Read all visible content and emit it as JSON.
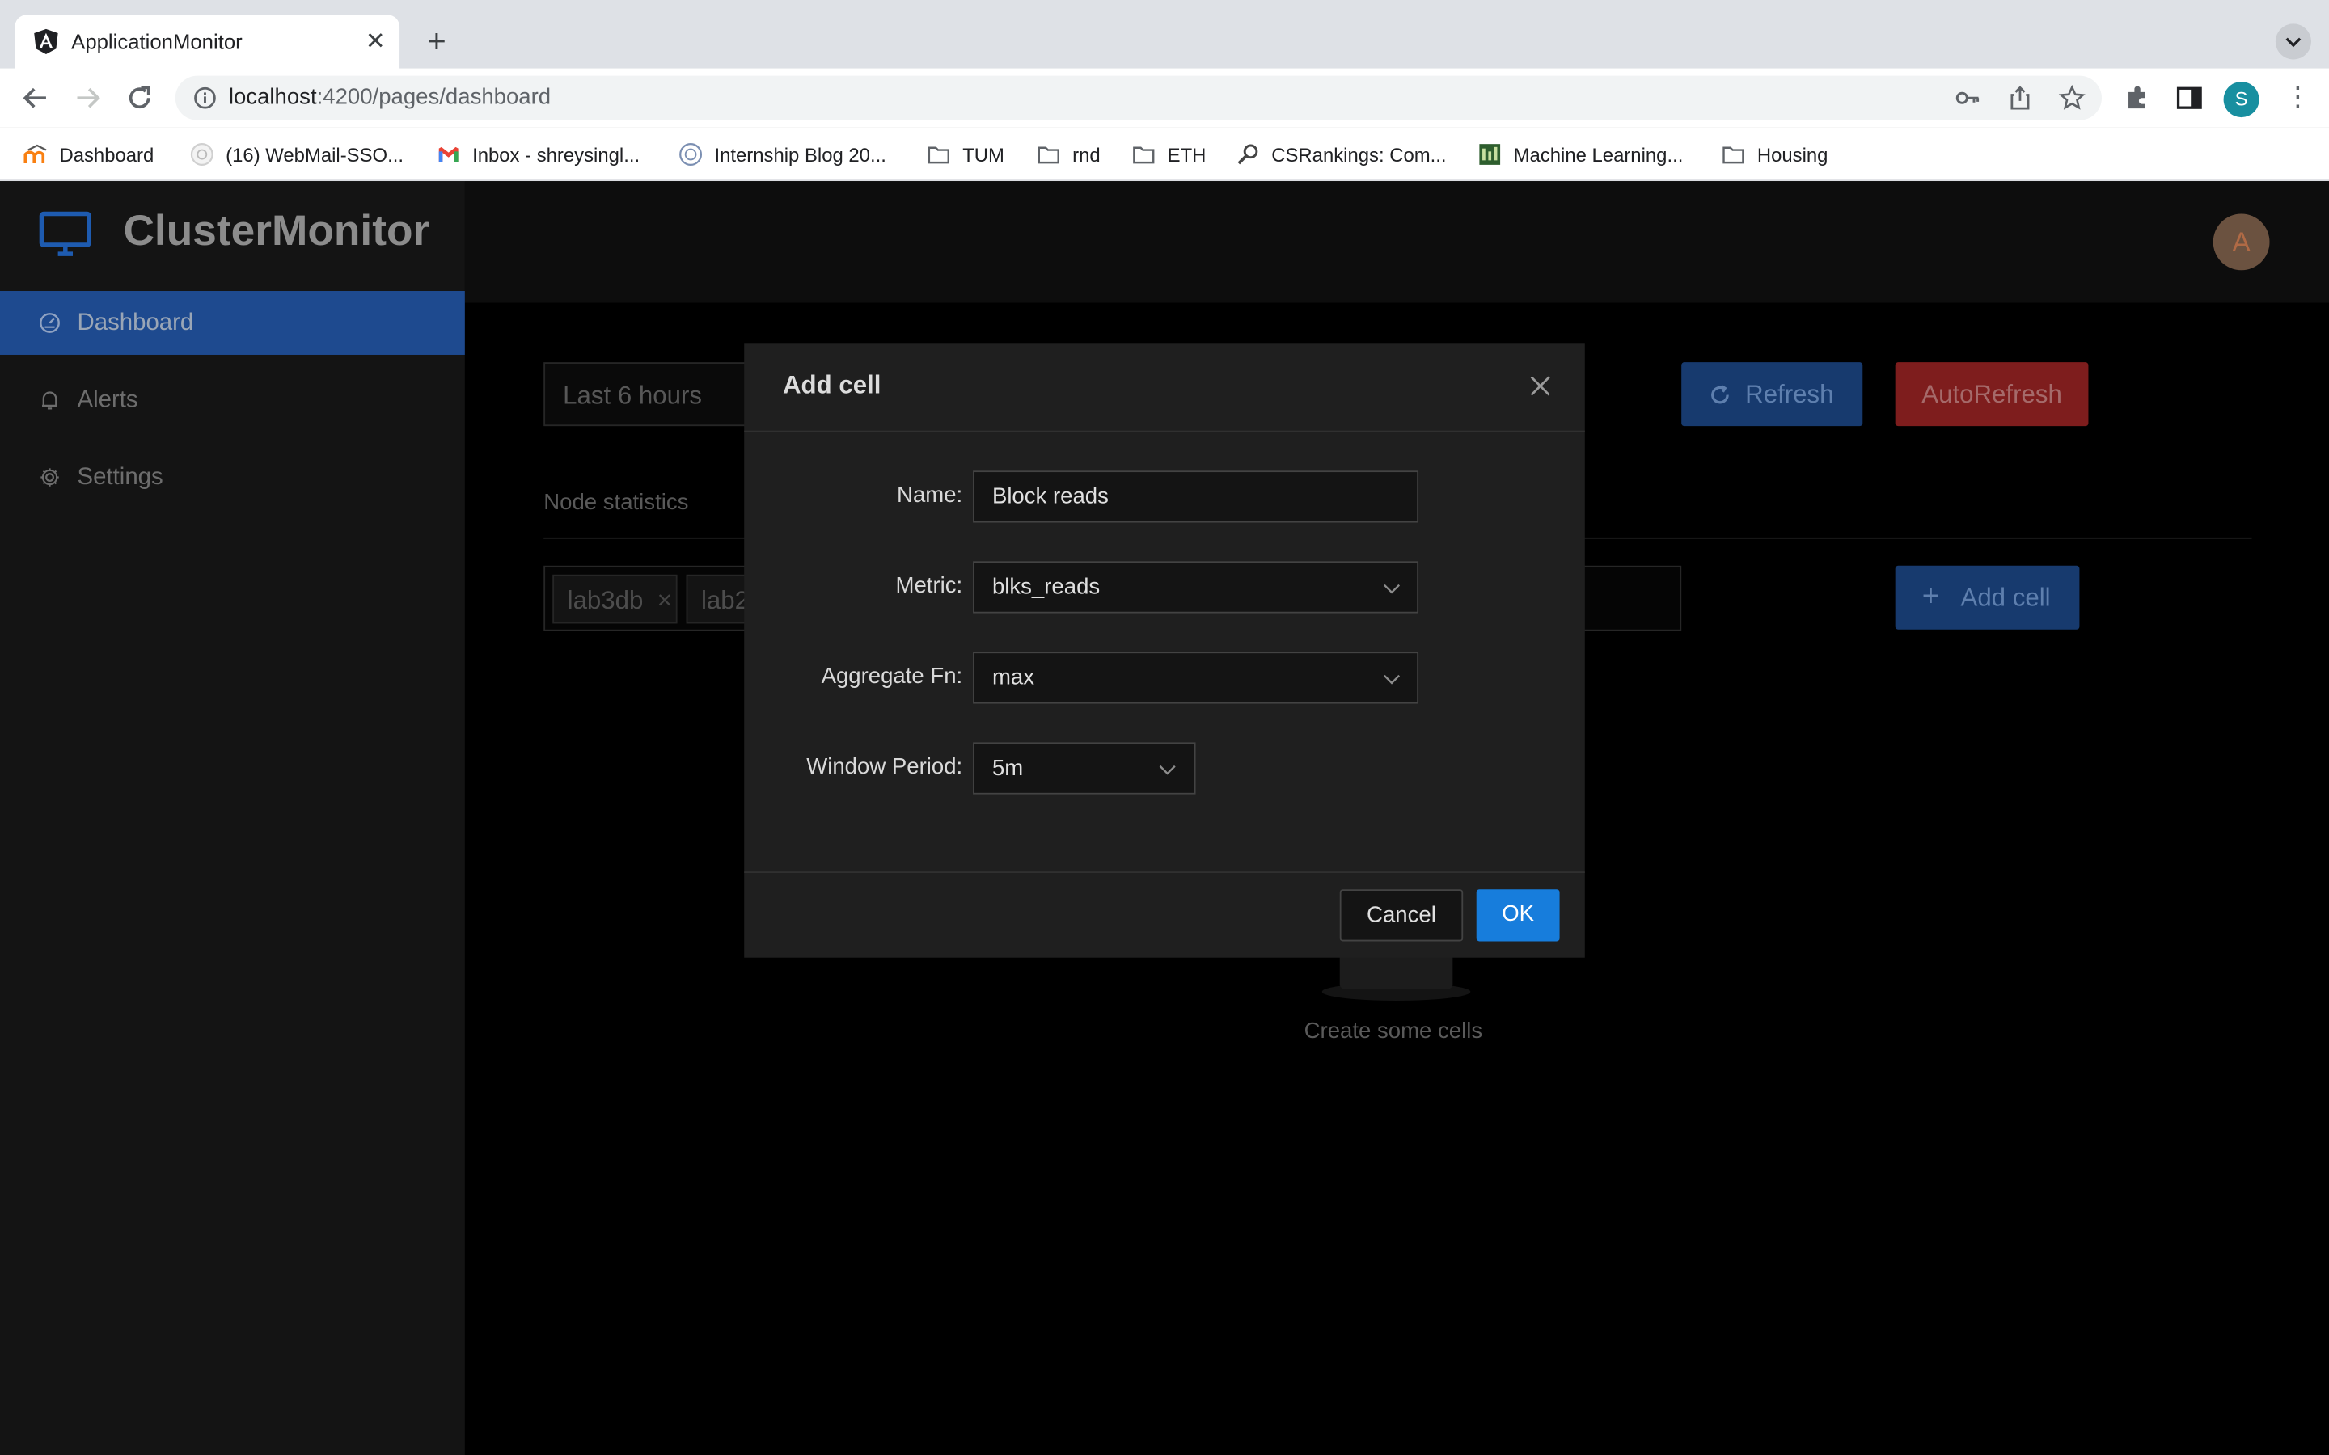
{
  "browser": {
    "tab_title": "ApplicationMonitor",
    "url_host": "localhost",
    "url_path": ":4200/pages/dashboard",
    "profile_initial": "S",
    "bookmarks": [
      {
        "label": "Dashboard",
        "icon": "moodle-icon"
      },
      {
        "label": "(16) WebMail-SSO...",
        "icon": "webmail-icon"
      },
      {
        "label": "Inbox - shreysingl...",
        "icon": "gmail-icon"
      },
      {
        "label": "Internship Blog 20...",
        "icon": "blog-icon"
      },
      {
        "label": "TUM",
        "icon": "folder-icon"
      },
      {
        "label": "rnd",
        "icon": "folder-icon"
      },
      {
        "label": "ETH",
        "icon": "folder-icon"
      },
      {
        "label": "CSRankings: Com...",
        "icon": "search-icon"
      },
      {
        "label": "Machine Learning...",
        "icon": "ml-icon"
      },
      {
        "label": "Housing",
        "icon": "folder-icon"
      }
    ]
  },
  "app": {
    "brand": "ClusterMonitor",
    "avatar_initial": "A",
    "nav": [
      {
        "label": "Dashboard",
        "icon": "dashboard-icon",
        "active": true
      },
      {
        "label": "Alerts",
        "icon": "bell-icon",
        "active": false
      },
      {
        "label": "Settings",
        "icon": "gear-icon",
        "active": false
      }
    ]
  },
  "dashboard": {
    "time_range": "Last 6 hours",
    "refresh_label": "Refresh",
    "autorefresh_label": "AutoRefresh",
    "section_title": "Node statistics",
    "tags": [
      "lab3db",
      "lab2"
    ],
    "add_cell_label": "Add cell",
    "empty_text": "Create some cells"
  },
  "modal": {
    "title": "Add cell",
    "fields": {
      "name": {
        "label": "Name",
        "value": "Block reads"
      },
      "metric": {
        "label": "Metric",
        "value": "blks_reads"
      },
      "aggregate": {
        "label": "Aggregate Fn",
        "value": "max"
      },
      "window": {
        "label": "Window Period",
        "value": "5m"
      }
    },
    "cancel_label": "Cancel",
    "ok_label": "OK"
  },
  "colors": {
    "primary": "#177ddc",
    "danger": "#7e1d1d",
    "sidebar_active": "#1e4a8f"
  }
}
